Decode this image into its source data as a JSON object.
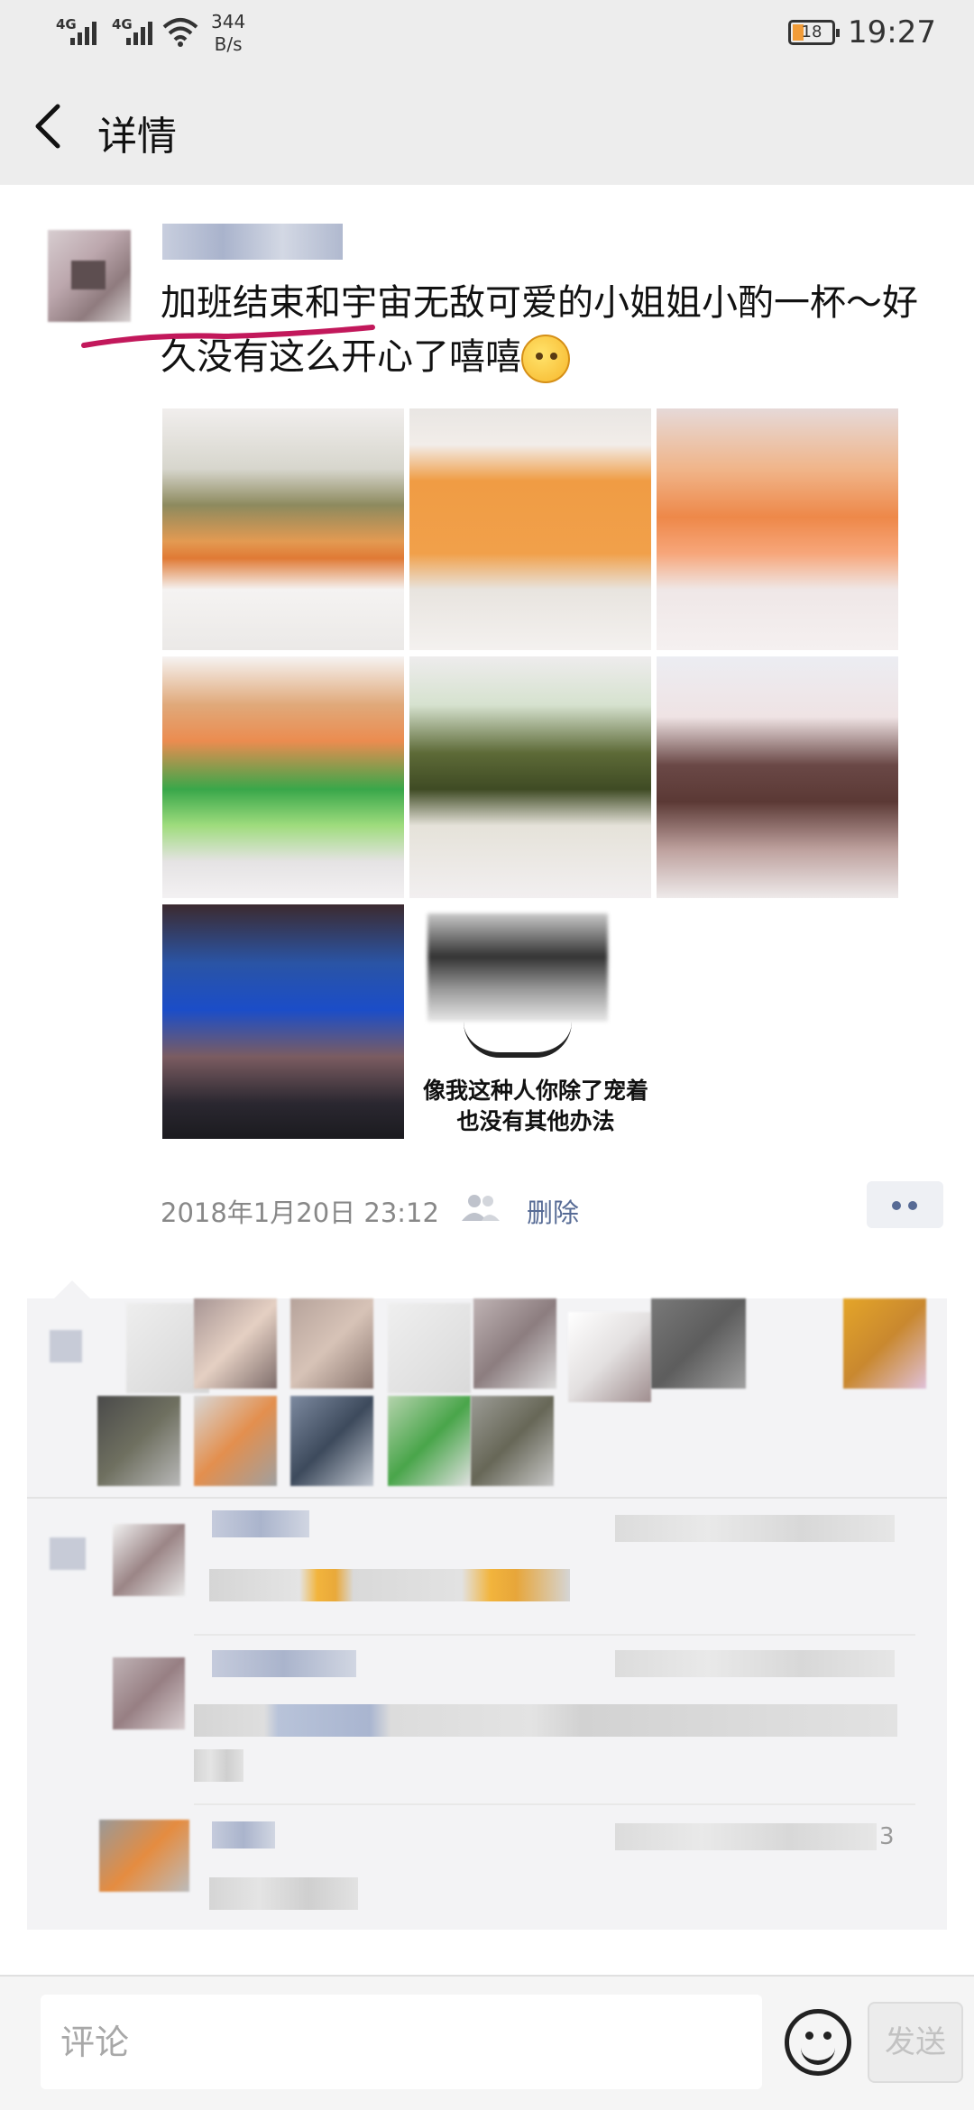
{
  "status_bar": {
    "signal1": "4G",
    "signal2": "4G",
    "speed_value": "344",
    "speed_unit": "B/s",
    "battery": "18",
    "time": "19:27"
  },
  "header": {
    "title": "详情"
  },
  "post": {
    "text": "加班结束和宇宙无敌可爱的小姐姐小酌一杯～好久没有这么开心了嘻嘻",
    "meme_caption_line1": "像我这种人你除了宠着",
    "meme_caption_line2": "也没有其他办法",
    "timestamp": "2018年1月20日 23:12",
    "delete_label": "删除",
    "highlight_color": "#c2185b"
  },
  "comments": {
    "visible_tail_digit": "3"
  },
  "input_bar": {
    "placeholder": "评论",
    "send_label": "发送"
  }
}
